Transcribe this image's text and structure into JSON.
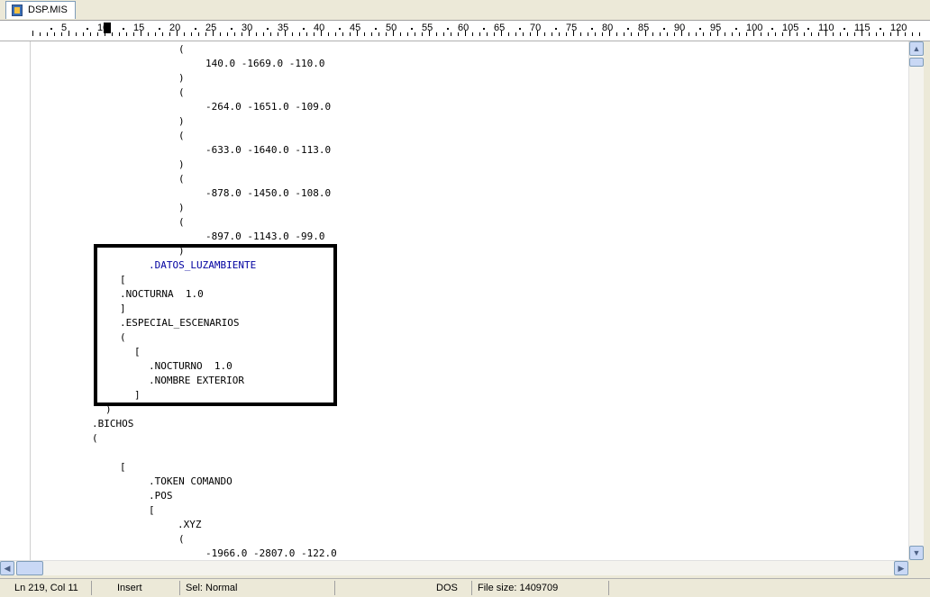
{
  "tab": {
    "label": "DSP.MIS",
    "icon": "document-icon"
  },
  "ruler": {
    "numbers": [
      "5",
      "10",
      "15",
      "20",
      "25",
      "30",
      "35",
      "40",
      "45",
      "50",
      "55",
      "60",
      "65",
      "70",
      "75",
      "80",
      "85",
      "90",
      "95",
      "100",
      "105",
      "110",
      "115",
      "120"
    ]
  },
  "editor": {
    "lines": [
      "(",
      "140.0 -1669.0 -110.0",
      ")",
      "(",
      "-264.0 -1651.0 -109.0",
      ")",
      "(",
      "-633.0 -1640.0 -113.0",
      ")",
      "(",
      "-878.0 -1450.0 -108.0",
      ")",
      "(",
      "-897.0 -1143.0 -99.0",
      ")",
      ".DATOS_LUZAMBIENTE",
      "[",
      ".NOCTURNA  1.0",
      "]",
      ".ESPECIAL_ESCENARIOS",
      "(",
      "[",
      ".NOCTURNO  1.0",
      ".NOMBRE EXTERIOR",
      "]",
      ")",
      ".BICHOS",
      "(",
      "[",
      ".TOKEN COMANDO",
      ".POS",
      "[",
      ".XYZ",
      "(",
      "-1966.0 -2807.0 -122.0"
    ]
  },
  "statusbar": {
    "position": "Ln 219, Col 11",
    "mode": "Insert",
    "selection": "Sel: Normal",
    "line_ending": "DOS",
    "file_size": "File size: 1409709"
  }
}
